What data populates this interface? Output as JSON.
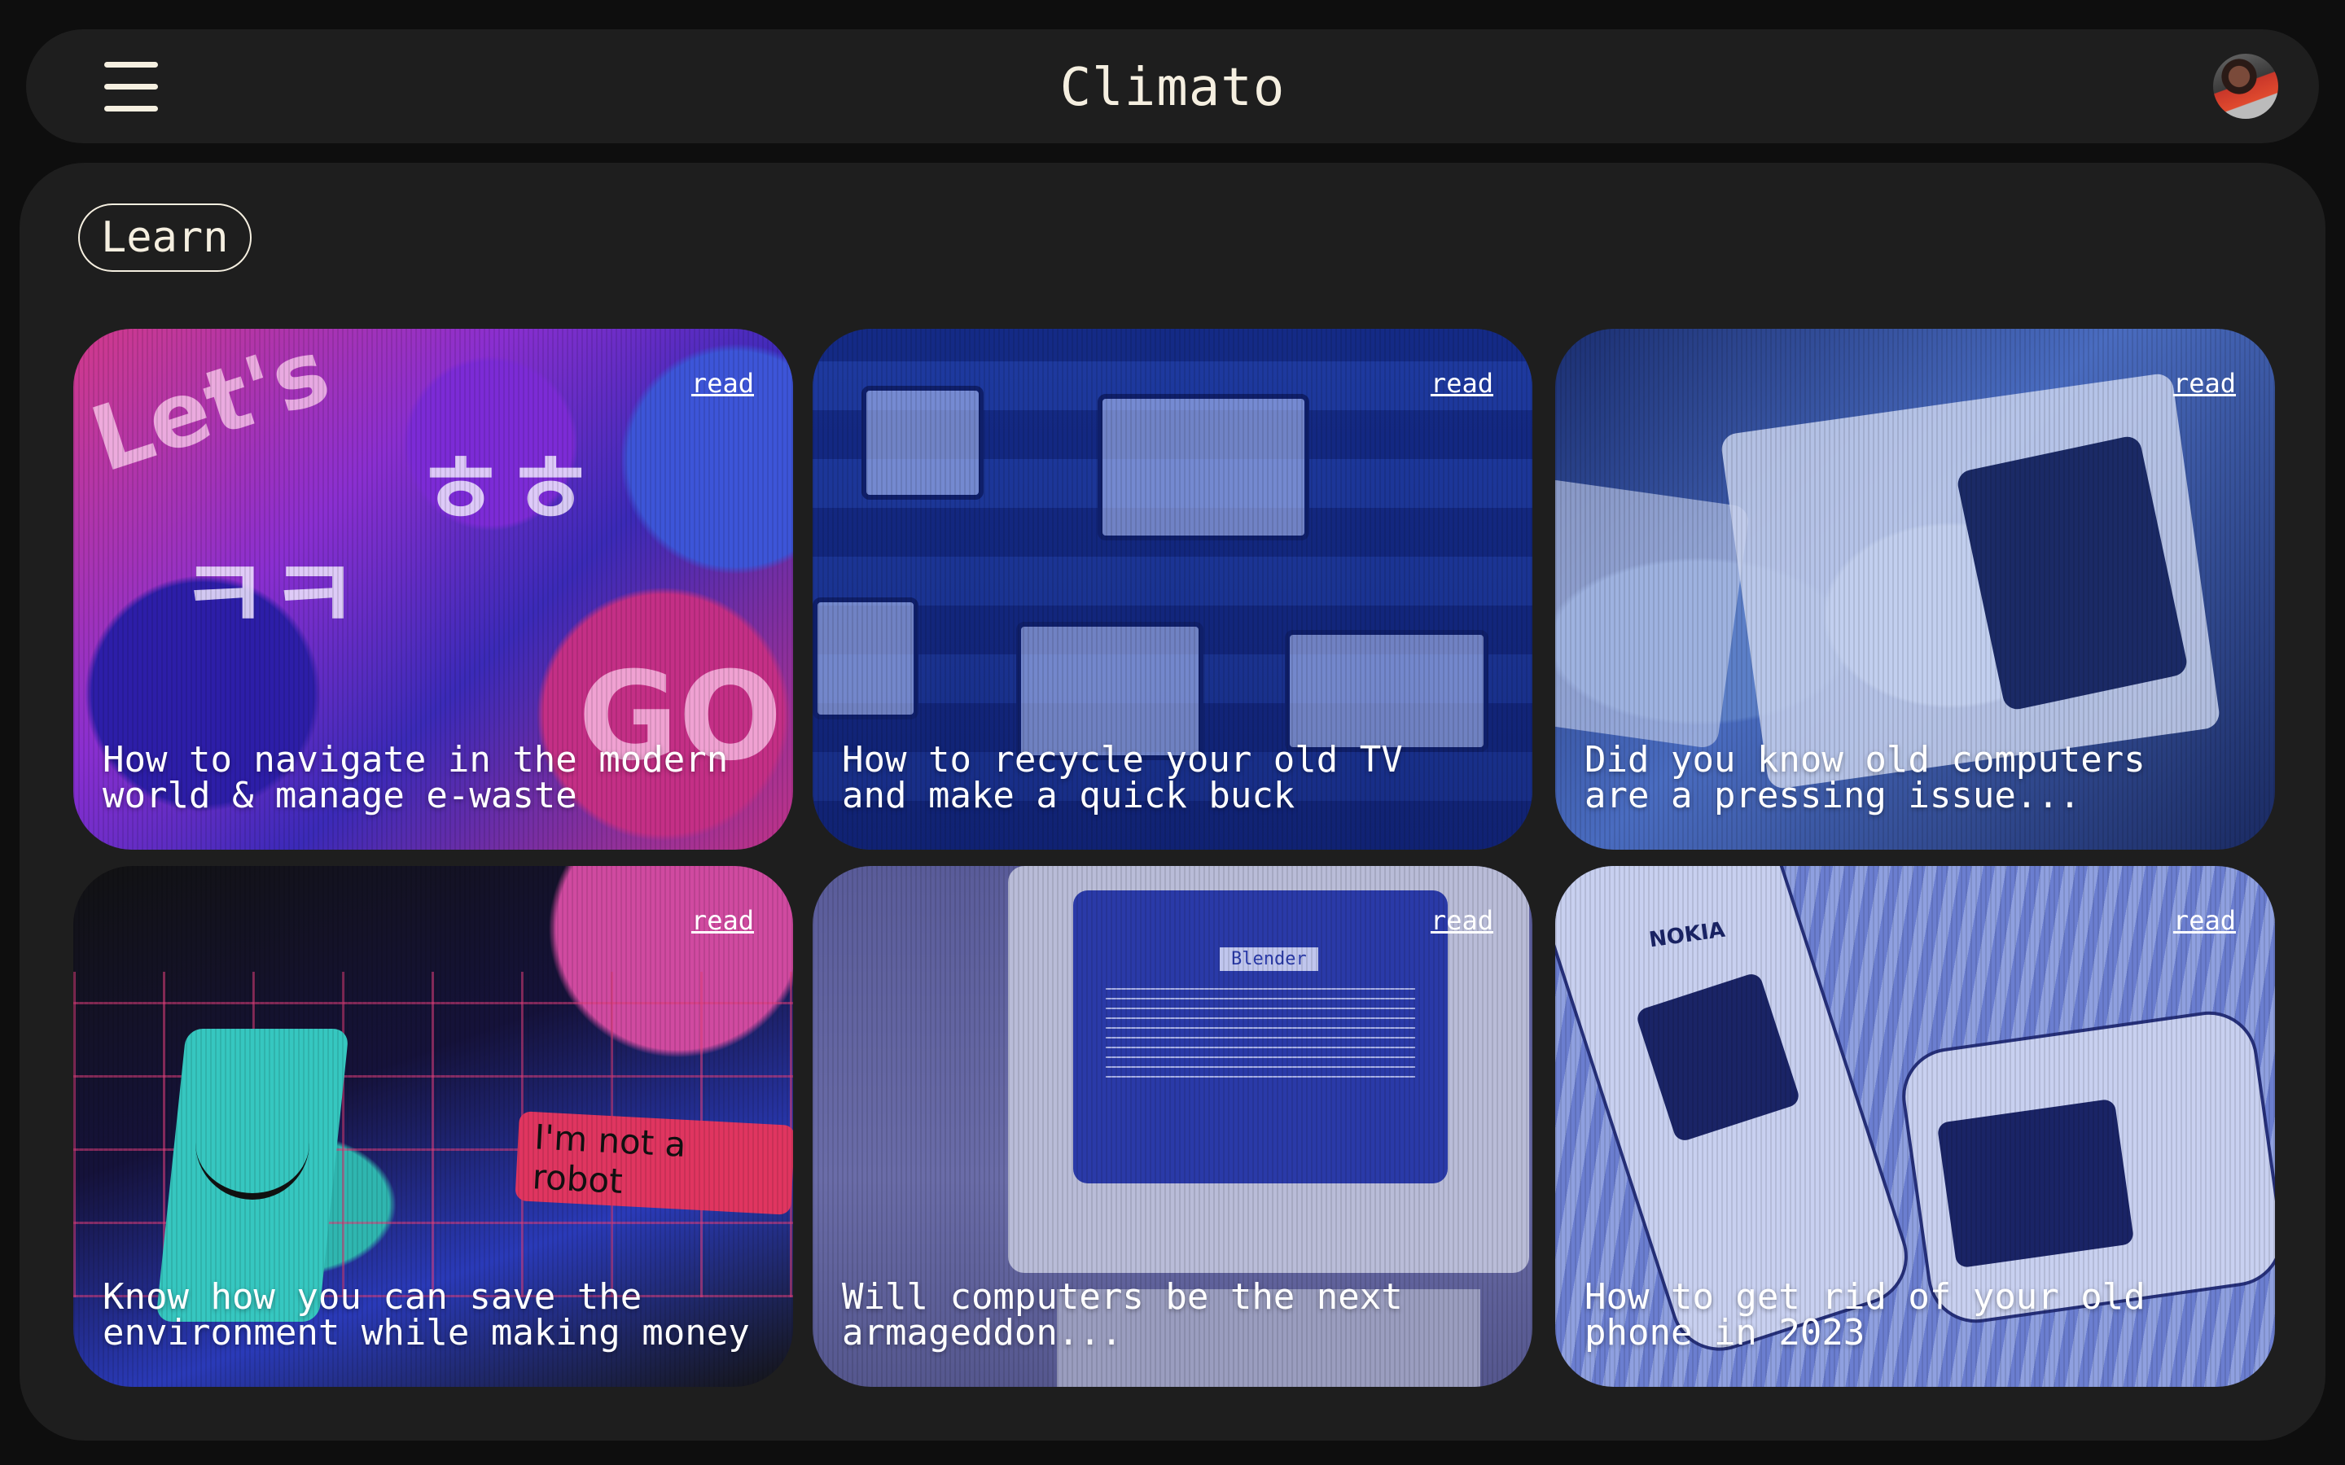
{
  "header": {
    "title": "Climato"
  },
  "section": {
    "label": "Learn"
  },
  "cards": [
    {
      "title": "How to navigate in the modern\nworld & manage e-waste",
      "action": "read"
    },
    {
      "title": "How to recycle your old TV\nand make a quick buck",
      "action": "read"
    },
    {
      "title": "Did you know old computers\nare a pressing issue...",
      "action": "read"
    },
    {
      "title": "Know how you can save the\nenvironment while making money",
      "action": "read"
    },
    {
      "title": "Will computers be the next\narmageddon...",
      "action": "read"
    },
    {
      "title": "How to get rid of your old\nphone in 2023",
      "action": "read"
    }
  ],
  "decor": {
    "card1_bubbles": [
      "Let's",
      "ㅋㅋ",
      "ㅎㅎ",
      "GO"
    ],
    "card4_badge": "I'm not a robot",
    "card5_screen_title": "Blender",
    "card6_brand": "NOKIA"
  },
  "colors": {
    "background": "#0e0e0e",
    "surface": "#1e1e1e",
    "text": "#f5efe0"
  }
}
